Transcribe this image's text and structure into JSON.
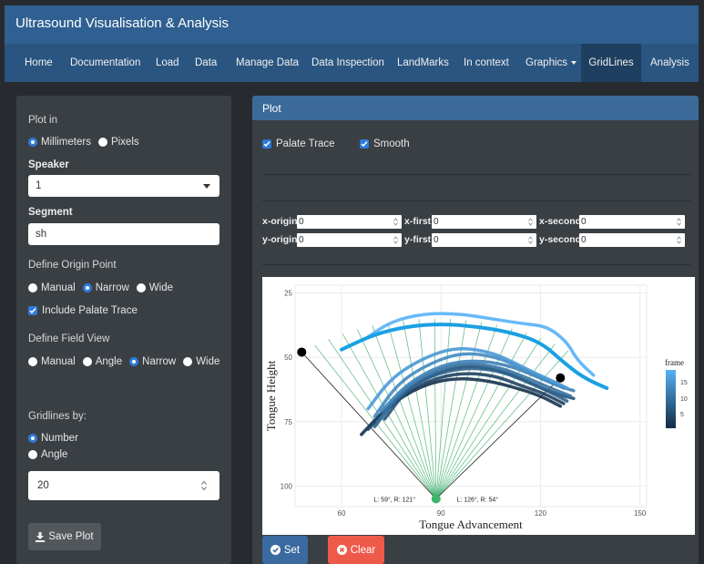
{
  "app": {
    "title": "Ultrasound Visualisation & Analysis"
  },
  "nav": {
    "items": [
      "Home",
      "Documentation",
      "Load",
      "Data",
      "Manage Data",
      "Data Inspection",
      "LandMarks",
      "In context",
      "Graphics",
      "GridLines",
      "Analysis"
    ],
    "active": "GridLines"
  },
  "sidebar": {
    "plot_in_label": "Plot in",
    "plot_in_options": [
      "Millimeters",
      "Pixels"
    ],
    "plot_in_selected": "Millimeters",
    "speaker_label": "Speaker",
    "speaker_value": "1",
    "segment_label": "Segment",
    "segment_value": "sh",
    "origin_label": "Define Origin Point",
    "origin_options": [
      "Manual",
      "Narrow",
      "Wide"
    ],
    "origin_selected": "Narrow",
    "include_palate_label": "Include Palate Trace",
    "include_palate_checked": true,
    "field_label": "Define Field View",
    "field_options": [
      "Manual",
      "Angle",
      "Narrow",
      "Wide"
    ],
    "field_selected": "Narrow",
    "gridlines_by_label": "Gridlines by:",
    "gridlines_options": [
      "Number",
      "Angle"
    ],
    "gridlines_selected": "Number",
    "gridlines_value": "20",
    "save_label": "Save Plot"
  },
  "panel": {
    "title": "Plot",
    "palate_trace_label": "Palate Trace",
    "palate_trace_checked": true,
    "smooth_label": "Smooth",
    "smooth_checked": true,
    "coords": {
      "x_origin_label": "x-origin",
      "x_origin_value": "0",
      "x_first_label": "x-first",
      "x_first_value": "0",
      "x_second_label": "x-second",
      "x_second_value": "0",
      "y_origin_label": "y-origin",
      "y_origin_value": "0",
      "y_first_label": "y-first",
      "y_first_value": "0",
      "y_second_label": "y-second",
      "y_second_value": "0"
    },
    "set_label": "Set",
    "clear_label": "Clear"
  },
  "chart_data": {
    "type": "line",
    "xlabel": "Tongue Advancement",
    "ylabel": "Tongue Height",
    "x_ticks": [
      60,
      90,
      120,
      150
    ],
    "y_ticks": [
      25,
      50,
      75,
      100
    ],
    "xlim": [
      46,
      152
    ],
    "ylim": [
      108,
      22
    ],
    "y_reversed": true,
    "grid": true,
    "legend": {
      "title": "frame",
      "ticks": [
        15,
        10,
        5
      ],
      "placement": "right",
      "colors": [
        "#132b43",
        "#56b1f7"
      ]
    },
    "origin": {
      "x": 88.5,
      "y": 105
    },
    "left_point": {
      "x": 48,
      "y": 48
    },
    "right_point": {
      "x": 126,
      "y": 58
    },
    "annotations": [
      {
        "text": "L: 59°, R: 121°",
        "x": 76,
        "y": 105
      },
      {
        "text": "L: 126°, R: 54°",
        "x": 101,
        "y": 105
      }
    ],
    "gridline_count": 20,
    "gridline_length": 70,
    "series": [
      {
        "frame": 18,
        "points": [
          [
            67,
            43
          ],
          [
            75,
            36
          ],
          [
            85,
            33
          ],
          [
            95,
            33
          ],
          [
            105,
            35
          ],
          [
            115,
            37
          ],
          [
            122,
            38
          ],
          [
            128,
            44
          ],
          [
            131,
            51
          ],
          [
            136,
            57
          ]
        ]
      },
      {
        "frame": 15,
        "points": [
          [
            68,
            70
          ],
          [
            75,
            58
          ],
          [
            85,
            50
          ],
          [
            95,
            46
          ],
          [
            105,
            48
          ],
          [
            112,
            52
          ],
          [
            118,
            56
          ],
          [
            125,
            60
          ],
          [
            128,
            62
          ]
        ]
      },
      {
        "frame": 13,
        "points": [
          [
            70,
            73
          ],
          [
            77,
            60
          ],
          [
            87,
            52
          ],
          [
            97,
            48
          ],
          [
            107,
            50
          ],
          [
            114,
            54
          ],
          [
            121,
            58
          ],
          [
            127,
            62
          ]
        ]
      },
      {
        "frame": 12,
        "points": [
          [
            72,
            71
          ],
          [
            80,
            60
          ],
          [
            90,
            53
          ],
          [
            100,
            51
          ],
          [
            110,
            53
          ],
          [
            118,
            57
          ],
          [
            125,
            61
          ],
          [
            130,
            63
          ]
        ]
      },
      {
        "frame": 10,
        "points": [
          [
            71,
            75
          ],
          [
            78,
            63
          ],
          [
            88,
            55
          ],
          [
            98,
            52
          ],
          [
            108,
            54
          ],
          [
            116,
            58
          ],
          [
            123,
            62
          ],
          [
            129,
            65
          ]
        ]
      },
      {
        "frame": 8,
        "points": [
          [
            70,
            77
          ],
          [
            77,
            65
          ],
          [
            87,
            57
          ],
          [
            97,
            54
          ],
          [
            107,
            55
          ],
          [
            115,
            59
          ],
          [
            122,
            63
          ],
          [
            128,
            67
          ]
        ]
      },
      {
        "frame": 6,
        "points": [
          [
            73,
            74
          ],
          [
            80,
            62
          ],
          [
            90,
            55
          ],
          [
            100,
            53
          ],
          [
            110,
            56
          ],
          [
            117,
            60
          ],
          [
            124,
            64
          ],
          [
            130,
            66
          ]
        ]
      },
      {
        "frame": 4,
        "points": [
          [
            68,
            78
          ],
          [
            76,
            67
          ],
          [
            86,
            59
          ],
          [
            96,
            56
          ],
          [
            106,
            57
          ],
          [
            114,
            61
          ],
          [
            121,
            64
          ],
          [
            127,
            68
          ]
        ]
      },
      {
        "frame": 2,
        "points": [
          [
            66,
            80
          ],
          [
            74,
            69
          ],
          [
            84,
            61
          ],
          [
            94,
            58
          ],
          [
            104,
            59
          ],
          [
            113,
            62
          ],
          [
            120,
            65
          ],
          [
            126,
            69
          ]
        ]
      }
    ],
    "palate": {
      "points": [
        [
          60,
          47
        ],
        [
          70,
          41
        ],
        [
          80,
          38
        ],
        [
          90,
          37
        ],
        [
          100,
          38
        ],
        [
          110,
          40
        ],
        [
          120,
          44
        ],
        [
          127,
          52
        ],
        [
          133,
          58
        ],
        [
          140,
          62
        ]
      ]
    }
  }
}
